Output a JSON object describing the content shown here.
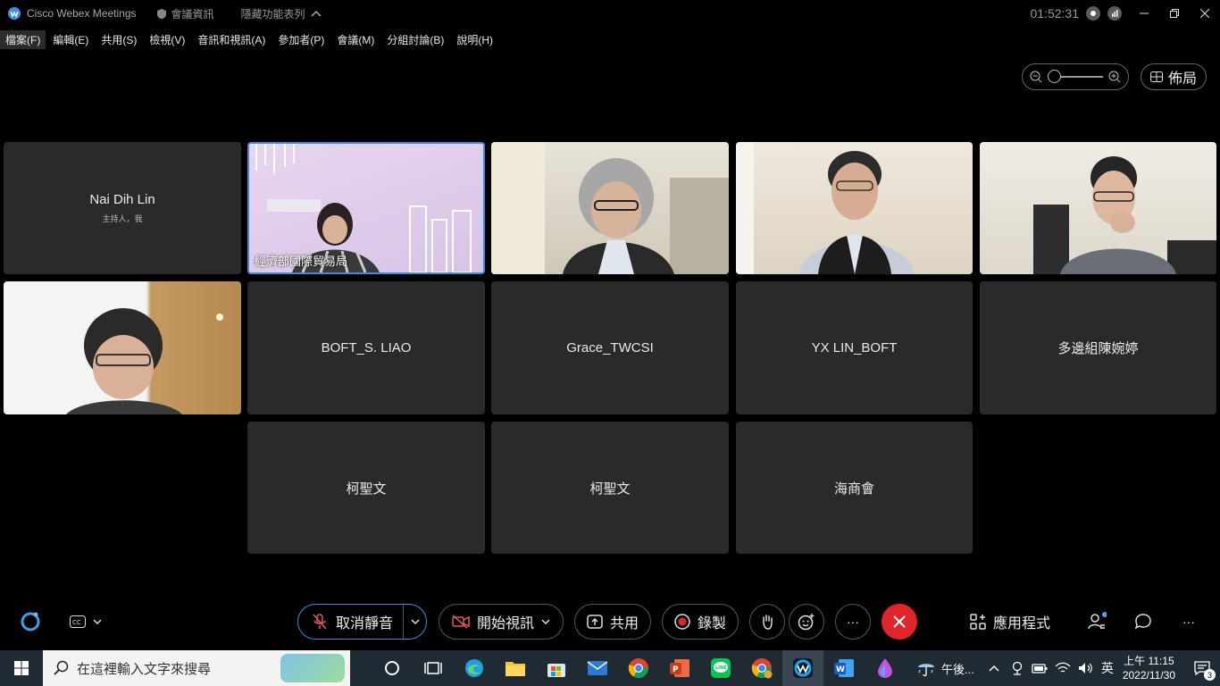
{
  "titlebar": {
    "app_title": "Cisco Webex Meetings",
    "meeting_info": "會議資訊",
    "hide_menu": "隱藏功能表列",
    "clock": "01:52:31"
  },
  "menu": [
    "檔案(F)",
    "編輯(E)",
    "共用(S)",
    "檢視(V)",
    "音訊和視訊(A)",
    "參加者(P)",
    "會議(M)",
    "分組討論(B)",
    "說明(H)"
  ],
  "layout_button": "佈局",
  "participants": {
    "host": {
      "name": "Nai Dih Lin",
      "role": "主持人，我"
    },
    "video_caption": "經濟部國際貿易局",
    "tiles": [
      "BOFT_S. LIAO",
      "Grace_TWCSI",
      "YX LIN_BOFT",
      "多邊組陳婉婷",
      "柯聖文",
      "柯聖文",
      "海商會"
    ]
  },
  "toolbar": {
    "unmute": "取消靜音",
    "start_video": "開始視訊",
    "share": "共用",
    "record": "錄製",
    "apps": "應用程式",
    "more": "···"
  },
  "taskbar": {
    "search_placeholder": "在這裡輸入文字來搜尋",
    "weather": "午後...",
    "ime": "英",
    "time": "上午 11:15",
    "date": "2022/11/30",
    "notifications": "3"
  }
}
